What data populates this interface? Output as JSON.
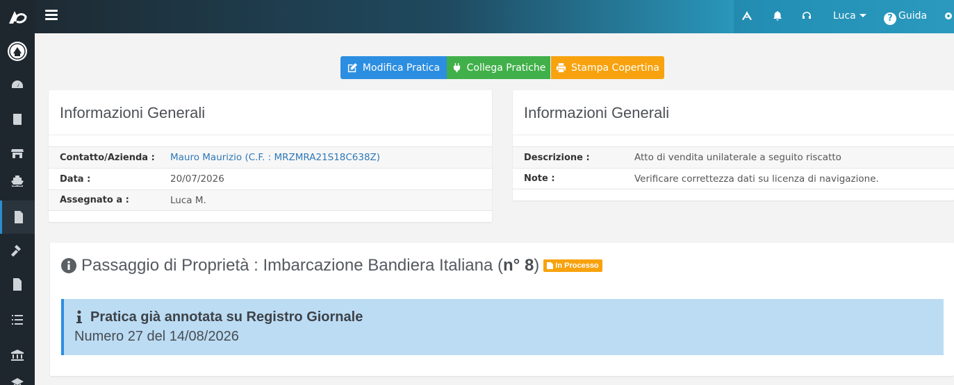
{
  "topbar": {
    "user_name": "Luca",
    "help_label": "Guida"
  },
  "actions": {
    "edit_label": "Modifica Pratica",
    "link_label": "Collega Pratiche",
    "print_label": "Stampa Copertina"
  },
  "card_left": {
    "title": "Informazioni Generali",
    "rows": [
      {
        "label": "Contatto/Azienda :",
        "value": "Mauro Maurizio (C.F. : MRZMRA21S18C638Z)"
      },
      {
        "label": "Data :",
        "value": "20/07/2026"
      },
      {
        "label": "Assegnato a :",
        "value": "Luca M."
      }
    ]
  },
  "card_right": {
    "title": "Informazioni Generali",
    "rows": [
      {
        "label": "Descrizione :",
        "value": "Atto di vendita unilaterale a seguito riscatto"
      },
      {
        "label": "Note :",
        "value": "Verificare correttezza dati su licenza di navigazione."
      }
    ]
  },
  "section": {
    "title_prefix": "Passaggio di Proprietà : Imbarcazione Bandiera Italiana (",
    "number": "n° 8",
    "title_suffix": ")",
    "status_badge": "In Processo",
    "status_color": "#f7a20e",
    "alert_title": "Pratica già annotata su Registro Giornale",
    "alert_text": "Numero 27 del 14/08/2026"
  },
  "colors": {
    "sidebar_bg": "#1f272e",
    "accent_blue": "#2c8ee0",
    "accent_green": "#41b04a",
    "accent_orange": "#f7a20e"
  }
}
